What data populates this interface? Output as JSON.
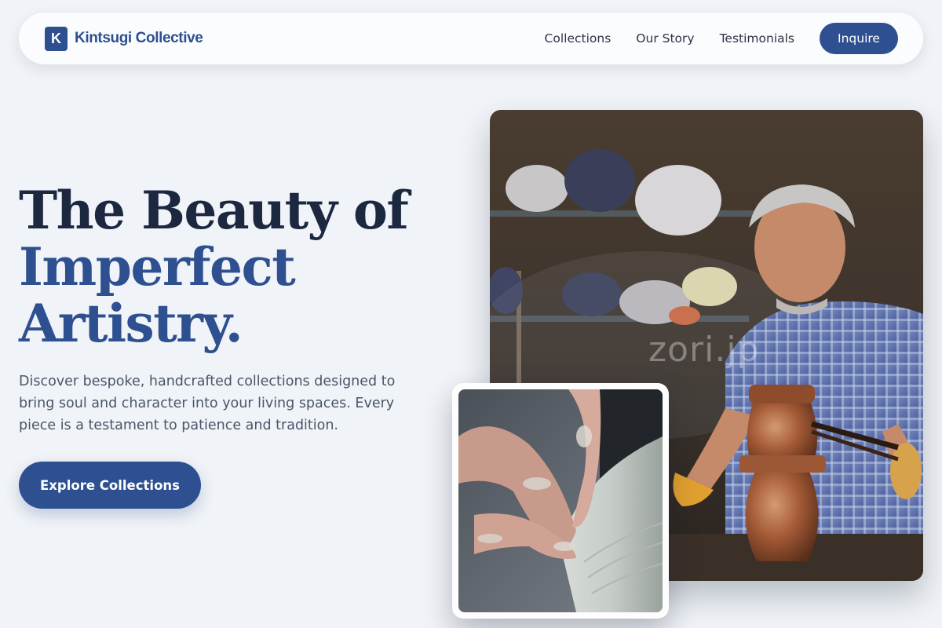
{
  "nav": {
    "brand_initial": "K",
    "brand_name": "Kintsugi Collective",
    "links": [
      {
        "label": "Collections"
      },
      {
        "label": "Our Story"
      },
      {
        "label": "Testimonials"
      }
    ],
    "cta_label": "Inquire"
  },
  "hero": {
    "headline_line1": "The Beauty of",
    "headline_line2": "Imperfect",
    "headline_line3": "Artistry.",
    "lede": "Discover bespoke, handcrafted collections designed to bring soul and character into your living spaces. Every piece is a testament to patience and tradition.",
    "cta_label": "Explore Collections"
  },
  "images": {
    "main_watermark": "zori.jp"
  },
  "colors": {
    "brand": "#2e5090",
    "heading": "#1c2740",
    "background": "#f0f3f7",
    "body_text": "#4a5568"
  }
}
